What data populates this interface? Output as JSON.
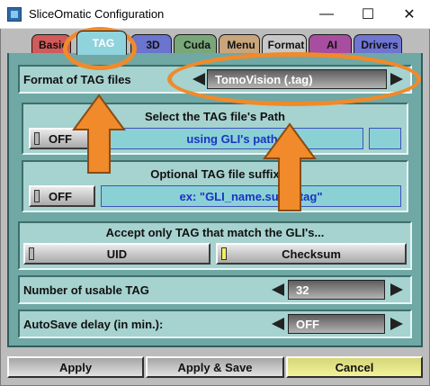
{
  "window": {
    "title": "SliceOmatic Configuration"
  },
  "tabs": [
    {
      "label": "Basic",
      "color": "#d35a5a"
    },
    {
      "label": "TAG",
      "color": "#8fd3dd"
    },
    {
      "label": "3D",
      "color": "#6b74cf"
    },
    {
      "label": "Cuda",
      "color": "#79a779"
    },
    {
      "label": "Menu",
      "color": "#c9a57c"
    },
    {
      "label": "Format",
      "color": "#c8c8c8"
    },
    {
      "label": "AI",
      "color": "#a84ea0"
    },
    {
      "label": "Drivers",
      "color": "#6f75d2"
    }
  ],
  "format_row": {
    "label": "Format of TAG files",
    "value": "TomoVision (.tag)"
  },
  "path_group": {
    "title": "Select the TAG file's Path",
    "toggle": "OFF",
    "value": "using GLI's path"
  },
  "suffix_group": {
    "title": "Optional TAG file suffix",
    "toggle": "OFF",
    "value": "ex: \"GLI_name.suffix.tag\""
  },
  "accept_group": {
    "title": "Accept only TAG that match the GLI's...",
    "uid": "UID",
    "checksum": "Checksum"
  },
  "usable_row": {
    "label": "Number of usable TAG",
    "value": "32"
  },
  "autosave_row": {
    "label": "AutoSave delay (in min.):",
    "value": "OFF"
  },
  "buttons": {
    "apply": "Apply",
    "apply_save": "Apply & Save",
    "cancel": "Cancel"
  }
}
